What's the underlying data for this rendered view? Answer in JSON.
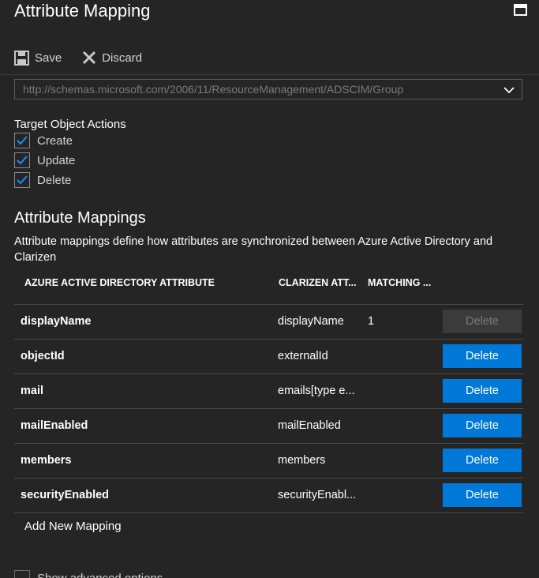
{
  "header": {
    "title": "Attribute Mapping"
  },
  "toolbar": {
    "save_label": "Save",
    "discard_label": "Discard"
  },
  "object_type_select": {
    "value": "http://schemas.microsoft.com/2006/11/ResourceManagement/ADSCIM/Group"
  },
  "target_actions": {
    "label": "Target Object Actions",
    "items": [
      {
        "label": "Create",
        "checked": true
      },
      {
        "label": "Update",
        "checked": true
      },
      {
        "label": "Delete",
        "checked": true
      }
    ]
  },
  "mappings": {
    "title": "Attribute Mappings",
    "description": "Attribute mappings define how attributes are synchronized between Azure Active Directory and Clarizen",
    "columns": [
      "AZURE ACTIVE DIRECTORY ATTRIBUTE",
      "CLARIZEN ATT...",
      "MATCHING ..."
    ],
    "rows": [
      {
        "source": "displayName",
        "target": "displayName",
        "matching": "1",
        "delete_label": "Delete",
        "delete_enabled": false
      },
      {
        "source": "objectId",
        "target": "externalId",
        "matching": "",
        "delete_label": "Delete",
        "delete_enabled": true
      },
      {
        "source": "mail",
        "target": "emails[type e...",
        "matching": "",
        "delete_label": "Delete",
        "delete_enabled": true
      },
      {
        "source": "mailEnabled",
        "target": "mailEnabled",
        "matching": "",
        "delete_label": "Delete",
        "delete_enabled": true
      },
      {
        "source": "members",
        "target": "members",
        "matching": "",
        "delete_label": "Delete",
        "delete_enabled": true
      },
      {
        "source": "securityEnabled",
        "target": "securityEnabl...",
        "matching": "",
        "delete_label": "Delete",
        "delete_enabled": true
      }
    ],
    "add_label": "Add New Mapping"
  },
  "advanced": {
    "label": "Show advanced options",
    "checked": false
  },
  "icons": {
    "maximize": "maximize-icon",
    "save": "save-icon",
    "discard": "close-icon",
    "dropdown": "chevron-down-icon",
    "check": "checkmark-icon"
  },
  "colors": {
    "background": "#252526",
    "accent": "#0078d7",
    "disabled_button": "#3b3b3b",
    "divider": "#4a4a4a"
  }
}
